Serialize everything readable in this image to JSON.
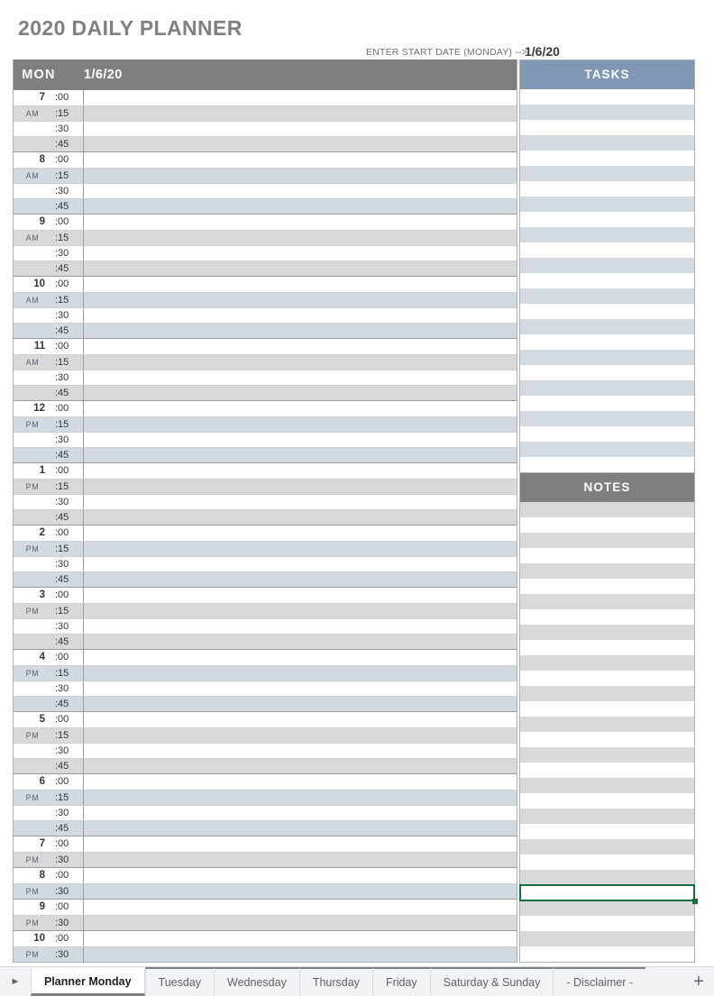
{
  "title": "2020 DAILY PLANNER",
  "start_date": {
    "label": "ENTER START DATE (MONDAY) -->",
    "value": "1/6/20"
  },
  "colors": {
    "title_gray": "#808080",
    "header_gray": "#7f7f7f",
    "tasks_blue": "#8198b5",
    "stripe_blue": "#d3d9e1",
    "stripe_gray": "#d9d9d9",
    "selection_green": "#13703c"
  },
  "schedule": {
    "day_label": "MON",
    "date_label": "1/6/20",
    "minute_labels": [
      ":00",
      ":15",
      ":30",
      ":45"
    ],
    "half_hour_labels": [
      ":00",
      ":30"
    ],
    "hours": [
      {
        "hour": "7",
        "meridiem": "AM",
        "tint": "gray",
        "slots": 4
      },
      {
        "hour": "8",
        "meridiem": "AM",
        "tint": "blue",
        "slots": 4
      },
      {
        "hour": "9",
        "meridiem": "AM",
        "tint": "gray",
        "slots": 4
      },
      {
        "hour": "10",
        "meridiem": "AM",
        "tint": "blue",
        "slots": 4
      },
      {
        "hour": "11",
        "meridiem": "AM",
        "tint": "gray",
        "slots": 4
      },
      {
        "hour": "12",
        "meridiem": "PM",
        "tint": "blue",
        "slots": 4
      },
      {
        "hour": "1",
        "meridiem": "PM",
        "tint": "gray",
        "slots": 4
      },
      {
        "hour": "2",
        "meridiem": "PM",
        "tint": "blue",
        "slots": 4
      },
      {
        "hour": "3",
        "meridiem": "PM",
        "tint": "gray",
        "slots": 4
      },
      {
        "hour": "4",
        "meridiem": "PM",
        "tint": "blue",
        "slots": 4
      },
      {
        "hour": "5",
        "meridiem": "PM",
        "tint": "gray",
        "slots": 4
      },
      {
        "hour": "6",
        "meridiem": "PM",
        "tint": "blue",
        "slots": 4
      },
      {
        "hour": "7",
        "meridiem": "PM",
        "tint": "gray",
        "slots": 2
      },
      {
        "hour": "8",
        "meridiem": "PM",
        "tint": "blue",
        "slots": 2
      },
      {
        "hour": "9",
        "meridiem": "PM",
        "tint": "gray",
        "slots": 2
      },
      {
        "hour": "10",
        "meridiem": "PM",
        "tint": "blue",
        "slots": 2
      }
    ]
  },
  "tasks_panel": {
    "header": "TASKS",
    "row_count": 25,
    "first_row_tint": "white",
    "entries": []
  },
  "notes_panel": {
    "header": "NOTES",
    "row_count": 30,
    "first_row_tint": "gray",
    "selected_row_index": 25,
    "entries": []
  },
  "sheet_tabs": {
    "nav_prev_icon": "triangle-right-icon",
    "add_label": "+",
    "items": [
      {
        "label": "Planner Monday",
        "active": true
      },
      {
        "label": "Tuesday",
        "active": false
      },
      {
        "label": "Wednesday",
        "active": false
      },
      {
        "label": "Thursday",
        "active": false
      },
      {
        "label": "Friday",
        "active": false
      },
      {
        "label": "Saturday & Sunday",
        "active": false
      },
      {
        "label": "- Disclaimer -",
        "active": false
      }
    ]
  }
}
